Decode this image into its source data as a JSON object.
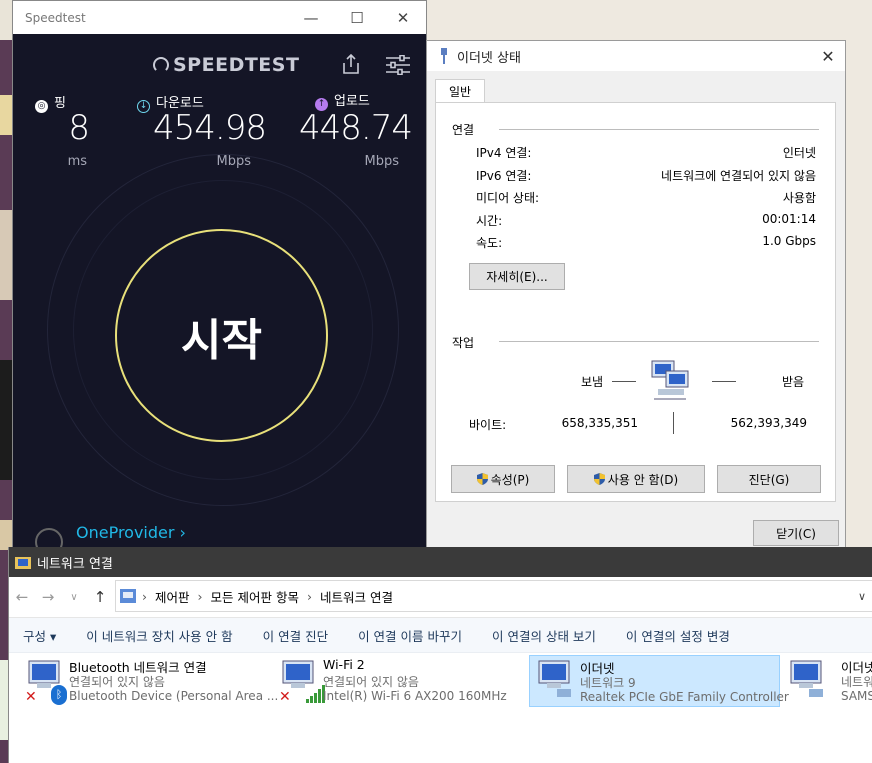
{
  "speedtest": {
    "window_title": "Speedtest",
    "logo": "SPEEDTEST",
    "ping": {
      "label": "핑",
      "value": "8",
      "unit": "ms"
    },
    "download": {
      "label": "다운로드",
      "value": "454.98",
      "unit": "Mbps"
    },
    "upload": {
      "label": "업로드",
      "value": "448.74",
      "unit": "Mbps"
    },
    "start_label": "시작",
    "provider": "OneProvider ›"
  },
  "status_dialog": {
    "title": "이더넷 상태",
    "tab": "일반",
    "connection_group": "연결",
    "rows": [
      {
        "label": "IPv4 연결:",
        "value": "인터넷"
      },
      {
        "label": "IPv6 연결:",
        "value": "네트워크에 연결되어 있지 않음"
      },
      {
        "label": "미디어 상태:",
        "value": "사용함"
      },
      {
        "label": "시간:",
        "value": "00:01:14"
      },
      {
        "label": "속도:",
        "value": "1.0 Gbps"
      }
    ],
    "details_button": "자세히(E)...",
    "activity_group": "작업",
    "sent_label": "보냄",
    "received_label": "받음",
    "bytes_label": "바이트:",
    "bytes_sent": "658,335,351",
    "bytes_received": "562,393,349",
    "properties_button": "속성(P)",
    "disable_button": "사용 안 함(D)",
    "diagnose_button": "진단(G)",
    "close_button": "닫기(C)"
  },
  "network_connections": {
    "title": "네트워크 연결",
    "breadcrumb": [
      "제어판",
      "모든 제어판 항목",
      "네트워크 연결"
    ],
    "commands": [
      "구성 ▾",
      "이 네트워크 장치 사용 안 함",
      "이 연결 진단",
      "이 연결 이름 바꾸기",
      "이 연결의 상태 보기",
      "이 연결의 설정 변경"
    ],
    "items": [
      {
        "name": "Bluetooth 네트워크 연결",
        "status": "연결되어 있지 않음",
        "device": "Bluetooth Device (Personal Area ..."
      },
      {
        "name": "Wi-Fi 2",
        "status": "연결되어 있지 않음",
        "device": "Intel(R) Wi-Fi 6 AX200 160MHz"
      },
      {
        "name": "이더넷",
        "status": "네트워크 9",
        "device": "Realtek PCIe GbE Family Controller"
      },
      {
        "name": "이더넷",
        "status": "네트워",
        "device": "SAMS"
      }
    ]
  },
  "colors": {
    "speedtest_bg": "#141526",
    "start_ring": "#e8e07a",
    "provider_link": "#21b8e6",
    "selection": "#cce8ff"
  }
}
